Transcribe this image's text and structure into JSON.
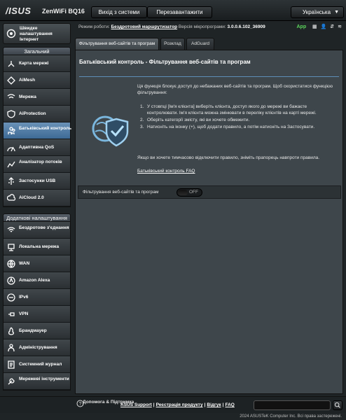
{
  "header": {
    "logo": "/ISUS",
    "model": "ZenWiFi BQ16",
    "logout_label": "Вихід з системи",
    "reboot_label": "Перезавантажити",
    "language": "Українська"
  },
  "status": {
    "mode_label": "Режим роботи:",
    "mode_value": "Бездротовий маршрутизатор",
    "fw_label": "Версія мікропрограми:",
    "fw_value": "3.0.0.6.102_36909",
    "app_label": "App"
  },
  "sidebar": {
    "qis_label": "Швидке налаштування Інтернет",
    "general_header": "Загальний",
    "general_items": [
      {
        "label": "Карта мережі"
      },
      {
        "label": "AiMesh"
      },
      {
        "label": "Мережа"
      },
      {
        "label": "AiProtection"
      },
      {
        "label": "Батьківський контроль"
      },
      {
        "label": "Адаптивна QoS"
      },
      {
        "label": "Аналізатор потоків"
      },
      {
        "label": "Застосунки USB"
      },
      {
        "label": "AiCloud 2.0"
      }
    ],
    "advanced_header": "Додаткові налаштування",
    "advanced_items": [
      {
        "label": "Бездротове з'єднання"
      },
      {
        "label": "Локальна мережа"
      },
      {
        "label": "WAN"
      },
      {
        "label": "Amazon Alexa"
      },
      {
        "label": "IPv6"
      },
      {
        "label": "VPN"
      },
      {
        "label": "Брандмауер"
      },
      {
        "label": "Адміністрування"
      },
      {
        "label": "Системний журнал"
      },
      {
        "label": "Мережеві інструменти"
      }
    ]
  },
  "tabs": [
    {
      "label": "Фільтрування веб-сайтів та програм"
    },
    {
      "label": "Розклад"
    },
    {
      "label": "AdGuard"
    }
  ],
  "main": {
    "title": "Батьківський контроль - Фільтрування веб-сайтів та програм",
    "intro": "Ця функція блокує доступ до небажаних веб-сайтів та програм. Щоб скористатися функцією фільтрування:",
    "steps": [
      "У стовпці [Ім'я клієнта] виберіть клієнта, доступ якого до мережі ви бажаєте контролювати. Ім'я клієнта можна змінювати в переліку клієнтів на карті мережі.",
      "Оберіть категорії змісту, які ви хочете обмежити.",
      "Натисніть на іконку (+), щоб додати правило, а потім натисніть на Застосувати."
    ],
    "note": "Якщо ви хочете тимчасово відключити правило, зніміть прапорець навпроти правила.",
    "faq_link": "Батьківський контроль FAQ",
    "setting_label": "Фільтрування веб-сайтів та програм",
    "toggle_text": "OFF"
  },
  "footer": {
    "help_label": "Допомога & Підтримка",
    "links": [
      "ASUS Support",
      "Реєстрація продукту",
      "Відгук",
      "FAQ"
    ],
    "copyright": "2024 ASUSTeK Computer Inc. Всі права застережені."
  }
}
